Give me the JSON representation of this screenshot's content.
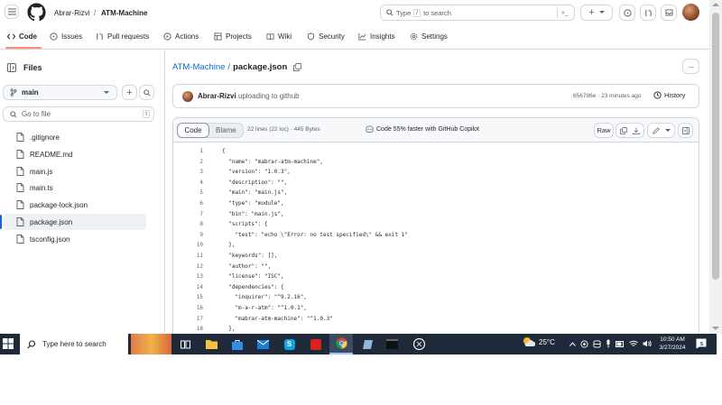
{
  "header": {
    "owner": "Abrar-Rizvi",
    "separator": "/",
    "repo": "ATM-Machine",
    "search_prefix": "Type",
    "search_key": "/",
    "search_suffix": "to search",
    "command_glyph": ">_",
    "plus_glyph": "+"
  },
  "repo_nav": {
    "tabs": [
      {
        "label": "Code"
      },
      {
        "label": "Issues"
      },
      {
        "label": "Pull requests"
      },
      {
        "label": "Actions"
      },
      {
        "label": "Projects"
      },
      {
        "label": "Wiki"
      },
      {
        "label": "Security"
      },
      {
        "label": "Insights"
      },
      {
        "label": "Settings"
      }
    ]
  },
  "sidebar": {
    "title": "Files",
    "branch": "main",
    "goto_placeholder": "Go to file",
    "goto_key": "t",
    "files": [
      {
        "name": ".gitignore"
      },
      {
        "name": "README.md"
      },
      {
        "name": "main.js"
      },
      {
        "name": "main.ts"
      },
      {
        "name": "package-lock.json"
      },
      {
        "name": "package.json",
        "selected": true
      },
      {
        "name": "tsconfig.json"
      }
    ]
  },
  "file": {
    "breadcrumb_repo": "ATM-Machine",
    "breadcrumb_sep": "/",
    "breadcrumb_file": "package.json",
    "commit_author": "Abrar-Rizvi",
    "commit_message": "uploading to github",
    "commit_meta": "656796e · 23 minutes ago",
    "history_label": "History",
    "code_tab": "Code",
    "blame_tab": "Blame",
    "file_info": "22 lines (22 loc) · 445 Bytes",
    "copilot_text": "Code 55% faster with GitHub Copilot",
    "raw_label": "Raw",
    "lines": [
      {
        "n": "1",
        "t": "{"
      },
      {
        "n": "2",
        "t": "  \"name\": \"mabrar-atm-machine\","
      },
      {
        "n": "3",
        "t": "  \"version\": \"1.0.3\","
      },
      {
        "n": "4",
        "t": "  \"description\": \"\","
      },
      {
        "n": "5",
        "t": "  \"main\": \"main.js\","
      },
      {
        "n": "6",
        "t": "  \"type\": \"module\","
      },
      {
        "n": "7",
        "t": "  \"bin\": \"main.js\","
      },
      {
        "n": "8",
        "t": "  \"scripts\": {"
      },
      {
        "n": "9",
        "t": "    \"test\": \"echo \\\"Error: no test specified\\\" && exit 1\""
      },
      {
        "n": "10",
        "t": "  },"
      },
      {
        "n": "11",
        "t": "  \"keywords\": [],"
      },
      {
        "n": "12",
        "t": "  \"author\": \"\","
      },
      {
        "n": "13",
        "t": "  \"license\": \"ISC\","
      },
      {
        "n": "14",
        "t": "  \"dependencies\": {"
      },
      {
        "n": "15",
        "t": "    \"inquirer\": \"^9.2.16\","
      },
      {
        "n": "16",
        "t": "    \"m-a-r-atm\": \"^1.0.1\","
      },
      {
        "n": "17",
        "t": "    \"mabrar-atm-machine\": \"^1.0.3\""
      },
      {
        "n": "18",
        "t": "  },"
      }
    ]
  },
  "taskbar": {
    "search_placeholder": "Type here to search",
    "weather": "25°C",
    "time": "10:50 AM",
    "date": "3/27/2024",
    "notification_count": "5"
  },
  "colors": {
    "link": "#0969da",
    "tab_underline": "#fd8c73",
    "selected_bar": "#0969da",
    "taskbar": "#1e2a3a"
  }
}
